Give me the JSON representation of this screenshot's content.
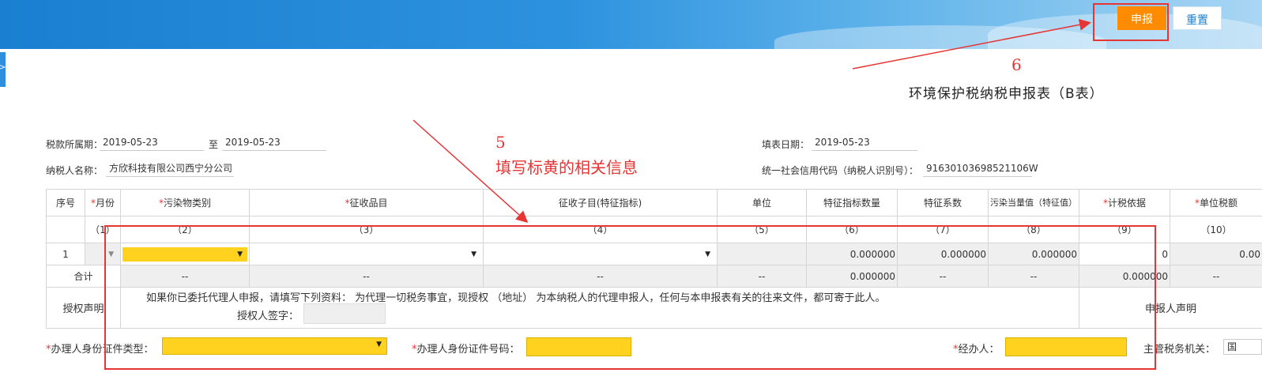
{
  "toolbar": {
    "submit_label": "申报",
    "reset_label": "重置"
  },
  "side_tab_icon": "chevron-right-icon",
  "annotations": {
    "step6": "6",
    "step5": "5",
    "step5_text": "填写标黄的相关信息"
  },
  "form_title": "环境保护税纳税申报表（B表）",
  "header": {
    "period_label": "税款所属期：",
    "period_start": "2019-05-23",
    "to_label": "至",
    "period_end": "2019-05-23",
    "fill_date_label": "填表日期：",
    "fill_date": "2019-05-23",
    "taxpayer_name_label": "纳税人名称：",
    "taxpayer_name": "方欣科技有限公司西宁分公司",
    "credit_code_label": "统一社会信用代码（纳税人识别号）：",
    "credit_code": "91630103698521106W"
  },
  "table": {
    "columns": [
      "序号",
      "月份",
      "污染物类别",
      "征收品目",
      "征收子目(特征指标)",
      "单位",
      "特征指标数量",
      "特征系数",
      "污染当量值（特征值）",
      "计税依据",
      "单位税额"
    ],
    "required_marks": [
      "",
      "*",
      "*",
      "*",
      "",
      "",
      "",
      "",
      "",
      "*",
      "*"
    ],
    "column_numbers": [
      "",
      "（1）",
      "（2）",
      "（3）",
      "（4）",
      "（5）",
      "（6）",
      "（7）",
      "（8）",
      "（9）",
      "（10）"
    ],
    "row1": {
      "seq": "1",
      "feature_qty": "0.000000",
      "feature_coef": "0.000000",
      "pollution_equiv": "0.000000",
      "tax_basis": "0",
      "unit_tax": "0.00"
    },
    "total": {
      "label": "合计",
      "dash": "--",
      "feature_qty": "0.000000",
      "tax_basis": "0.000000"
    },
    "auth_label": "授权声明",
    "declarant_label": "申报人声明"
  },
  "authorization": {
    "text": "如果你已委托代理人申报，请填写下列资料：  为代理一切税务事宜，现授权              （地址）      为本纳税人的代理申报人，任何与本申报表有关的往来文件，都可寄于此人。",
    "sign_label": "授权人签字："
  },
  "bottom": {
    "id_type_label": "办理人身份证件类型：",
    "id_number_label": "办理人身份证件号码：",
    "handler_label": "经办人：",
    "tax_authority_label": "主管税务机关：",
    "tax_authority_value": "国"
  },
  "colors": {
    "accent": "#1a7fd0",
    "submit": "#ff8c00",
    "highlight": "#ffd21f",
    "annotation": "#e53535"
  }
}
